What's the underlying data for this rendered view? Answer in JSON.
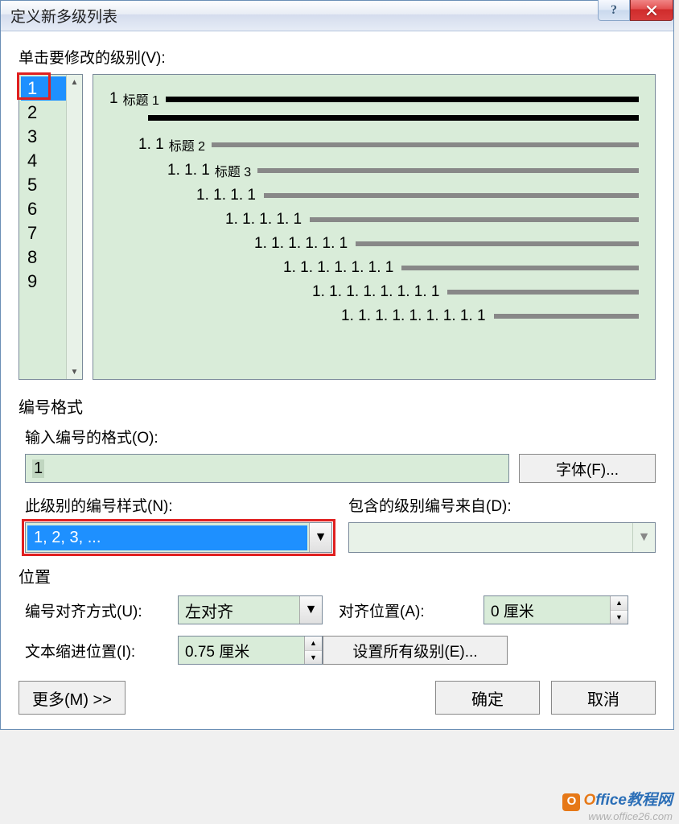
{
  "title": "定义新多级列表",
  "help_symbol": "?",
  "section_click_level": "单击要修改的级别(V):",
  "levels": [
    "1",
    "2",
    "3",
    "4",
    "5",
    "6",
    "7",
    "8",
    "9"
  ],
  "selected_level": 0,
  "preview": [
    {
      "indent": 0,
      "num": "1",
      "label": "标题 1",
      "style": "black"
    },
    {
      "indent": 36,
      "num": "1. 1",
      "label": "标题 2",
      "style": "gray"
    },
    {
      "indent": 72,
      "num": "1. 1. 1",
      "label": "标题 3",
      "style": "gray"
    },
    {
      "indent": 108,
      "num": "1. 1. 1. 1",
      "label": "",
      "style": "gray"
    },
    {
      "indent": 144,
      "num": "1. 1. 1. 1. 1",
      "label": "",
      "style": "gray"
    },
    {
      "indent": 180,
      "num": "1. 1. 1. 1. 1. 1",
      "label": "",
      "style": "gray"
    },
    {
      "indent": 216,
      "num": "1. 1. 1. 1. 1. 1. 1",
      "label": "",
      "style": "gray"
    },
    {
      "indent": 252,
      "num": "1. 1. 1. 1. 1. 1. 1. 1",
      "label": "",
      "style": "gray"
    },
    {
      "indent": 288,
      "num": "1. 1. 1. 1. 1. 1. 1. 1. 1",
      "label": "",
      "style": "gray"
    }
  ],
  "number_format_section": "编号格式",
  "enter_format_label": "输入编号的格式(O):",
  "format_value": "1",
  "font_button": "字体(F)...",
  "number_style_label": "此级别的编号样式(N):",
  "number_style_value": "1, 2, 3, ...",
  "include_from_label": "包含的级别编号来自(D):",
  "include_from_value": "",
  "position_section": "位置",
  "align_label": "编号对齐方式(U):",
  "align_value": "左对齐",
  "align_at_label": "对齐位置(A):",
  "align_at_value": "0 厘米",
  "indent_label": "文本缩进位置(I):",
  "indent_value": "0.75 厘米",
  "set_all_button": "设置所有级别(E)...",
  "more_button": "更多(M) >>",
  "ok_button": "确定",
  "cancel_button": "取消",
  "watermark": {
    "badge": "O",
    "brand_o": "O",
    "brand_rest": "ffice教程网",
    "sub": "www.office26.com"
  }
}
